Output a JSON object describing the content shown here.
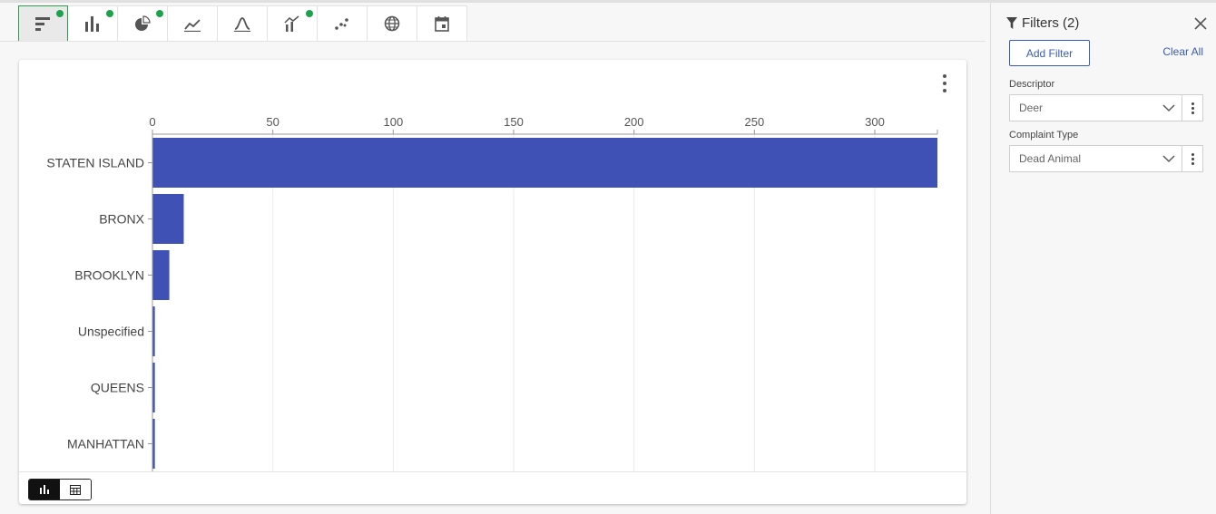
{
  "toolbar": {
    "buttons": [
      {
        "name": "horizontal-bar-chart-icon",
        "active": true,
        "dot": true
      },
      {
        "name": "vertical-bar-chart-icon",
        "active": false,
        "dot": true
      },
      {
        "name": "pie-chart-icon",
        "active": false,
        "dot": true
      },
      {
        "name": "line-chart-icon",
        "active": false,
        "dot": false
      },
      {
        "name": "area-curve-icon",
        "active": false,
        "dot": false
      },
      {
        "name": "combo-chart-icon",
        "active": false,
        "dot": true
      },
      {
        "name": "scatter-plot-icon",
        "active": false,
        "dot": false
      },
      {
        "name": "globe-map-icon",
        "active": false,
        "dot": false
      },
      {
        "name": "calendar-icon",
        "active": false,
        "dot": false
      }
    ],
    "dot_color": "#1aa34a"
  },
  "chart_data": {
    "type": "bar",
    "orientation": "horizontal",
    "categories": [
      "STATEN ISLAND",
      "BRONX",
      "BROOKLYN",
      "Unspecified",
      "QUEENS",
      "MANHATTAN"
    ],
    "values": [
      326,
      13,
      7,
      1,
      1,
      1
    ],
    "xlim": [
      0,
      326
    ],
    "xticks": [
      0,
      50,
      100,
      150,
      200,
      250,
      300
    ],
    "axis_position": "top",
    "grid": true,
    "bar_color": "#3f51b5"
  },
  "view_toggle": {
    "options": [
      "bar-chart-view-icon",
      "table-view-icon"
    ],
    "selected": "bar-chart-view-icon"
  },
  "filters": {
    "title": "Filters (2)",
    "add_label": "Add Filter",
    "clear_label": "Clear All",
    "items": [
      {
        "label": "Descriptor",
        "value": "Deer"
      },
      {
        "label": "Complaint Type",
        "value": "Dead Animal"
      }
    ]
  }
}
